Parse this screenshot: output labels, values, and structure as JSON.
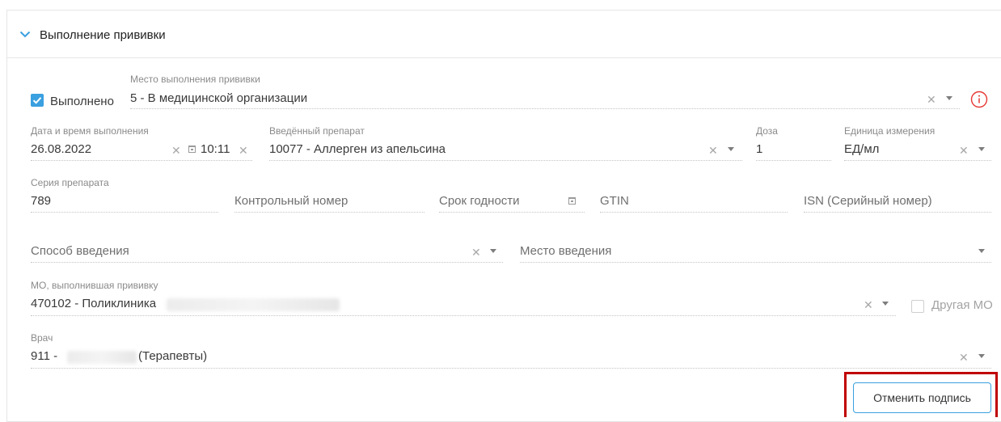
{
  "section": {
    "title": "Выполнение прививки"
  },
  "done_checkbox": {
    "label": "Выполнено",
    "checked": true
  },
  "place": {
    "label": "Место выполнения прививки",
    "value": "5 - В медицинской организации"
  },
  "datetime": {
    "label": "Дата и время выполнения",
    "date": "26.08.2022",
    "time": "10:11"
  },
  "drug": {
    "label": "Введённый препарат",
    "value": "10077 - Аллерген из апельсина"
  },
  "dose": {
    "label": "Доза",
    "value": "1"
  },
  "unit": {
    "label": "Единица измерения",
    "value": "ЕД/мл"
  },
  "series": {
    "label": "Серия препарата",
    "value": "789"
  },
  "control_number": {
    "placeholder": "Контрольный номер"
  },
  "expiry": {
    "placeholder": "Срок годности"
  },
  "gtin": {
    "placeholder": "GTIN"
  },
  "isn": {
    "placeholder": "ISN (Серийный номер)"
  },
  "route": {
    "placeholder": "Способ введения"
  },
  "site": {
    "placeholder": "Место введения"
  },
  "mo": {
    "label": "МО, выполнившая прививку",
    "value_prefix": "470102 - Поликлиника"
  },
  "other_mo": {
    "label": "Другая МО",
    "checked": false
  },
  "doctor": {
    "label": "Врач",
    "value_prefix": "911 -",
    "value_suffix": "(Терапевты)"
  },
  "cancel_sign_button": {
    "label": "Отменить подпись"
  },
  "icons": {
    "collapse": "chevron-down-icon",
    "clear": "clear-icon",
    "dropdown": "caret-down-icon",
    "calendar": "calendar-icon",
    "info": "info-icon",
    "check": "check-icon"
  },
  "colors": {
    "accent": "#3aa0e0",
    "highlight": "#c00000",
    "info": "#e53935"
  }
}
